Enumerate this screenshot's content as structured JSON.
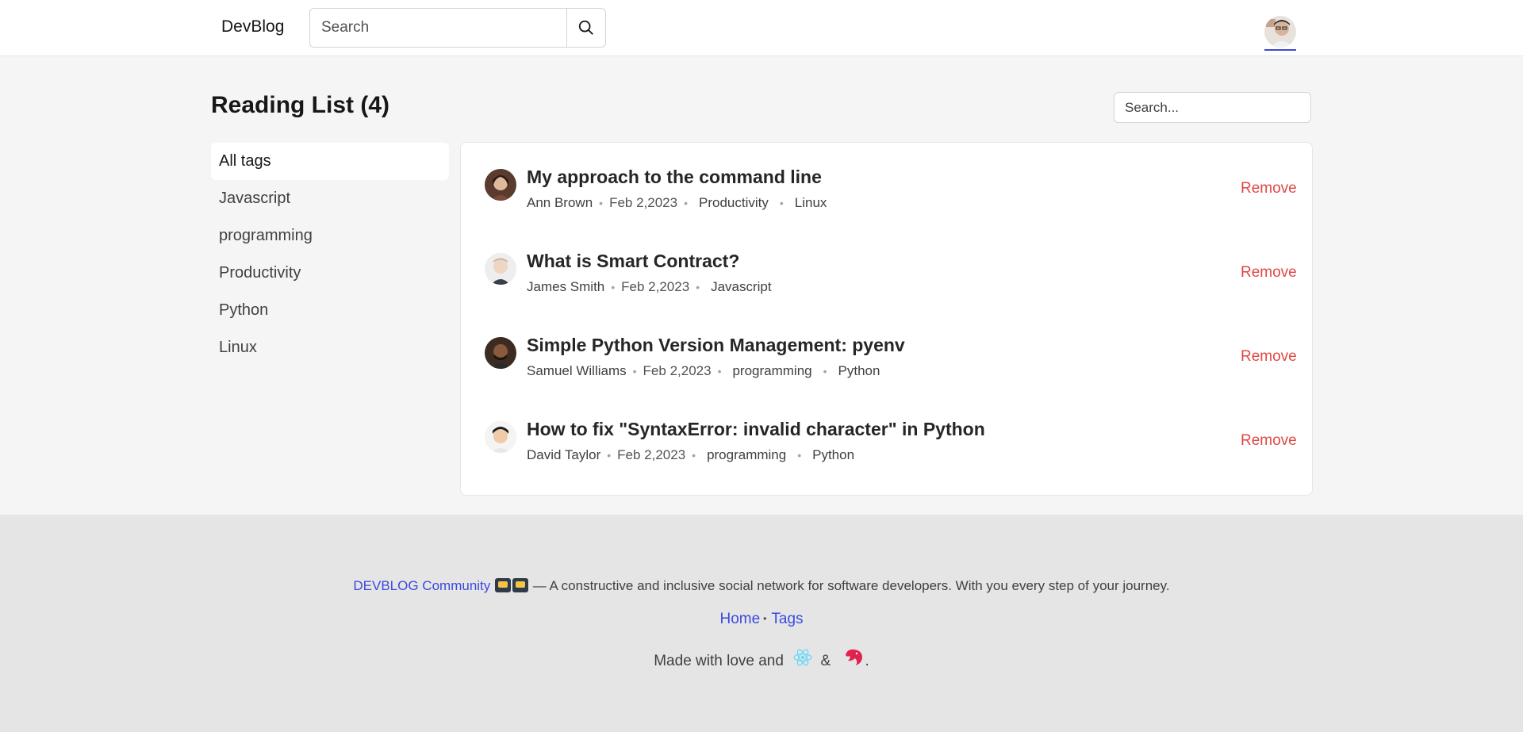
{
  "header": {
    "brand": "DevBlog",
    "search_placeholder": "Search"
  },
  "main": {
    "title": "Reading List (4)",
    "search_placeholder": "Search...",
    "tags": [
      "All tags",
      "Javascript",
      "programming",
      "Productivity",
      "Python",
      "Linux"
    ],
    "remove_label": "Remove",
    "items": [
      {
        "title": "My approach to the command line",
        "author": "Ann Brown",
        "date": "Feb 2,2023",
        "tags": [
          "Productivity",
          "Linux"
        ]
      },
      {
        "title": "What is Smart Contract?",
        "author": "James Smith",
        "date": "Feb 2,2023",
        "tags": [
          "Javascript"
        ]
      },
      {
        "title": "Simple Python Version Management: pyenv",
        "author": "Samuel Williams",
        "date": "Feb 2,2023",
        "tags": [
          "programming",
          "Python"
        ]
      },
      {
        "title": "How to fix \"SyntaxError: invalid character\" in Python",
        "author": "David Taylor",
        "date": "Feb 2,2023",
        "tags": [
          "programming",
          "Python"
        ]
      }
    ]
  },
  "footer": {
    "community_link": "DEVBLOG Community",
    "tagline": "— A constructive and inclusive social network for software developers. With you every step of your journey.",
    "home_link": "Home",
    "tags_link": "Tags",
    "made_with": "Made with love and",
    "amp": "&",
    "period": "."
  },
  "colors": {
    "accent": "#3b49df",
    "remove": "#dc2626",
    "react": "#61dafb",
    "nest": "#e0234e"
  }
}
